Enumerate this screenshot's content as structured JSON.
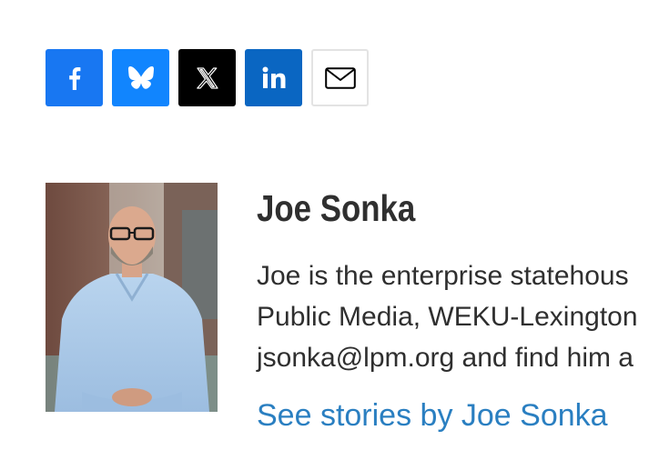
{
  "share": {
    "buttons": [
      {
        "network": "facebook",
        "icon": "facebook-icon",
        "color": "#1877f2"
      },
      {
        "network": "bluesky",
        "icon": "bluesky-icon",
        "color": "#1185fe"
      },
      {
        "network": "x",
        "icon": "x-icon",
        "color": "#000000"
      },
      {
        "network": "linkedin",
        "icon": "linkedin-icon",
        "color": "#0a66c2"
      },
      {
        "network": "email",
        "icon": "mail-icon",
        "color": "#ffffff"
      }
    ]
  },
  "author": {
    "name": "Joe Sonka",
    "bio_lines": [
      "Joe is the enterprise statehous",
      "Public Media, WEKU-Lexington",
      "jsonka@lpm.org and find him a"
    ],
    "stories_link": "See stories by Joe Sonka",
    "link_color": "#2a7fc1"
  }
}
